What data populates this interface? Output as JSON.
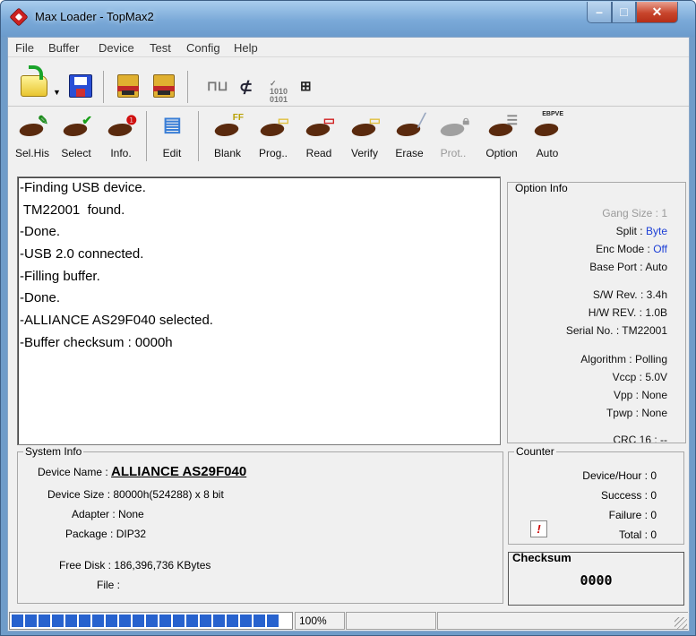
{
  "window": {
    "title": "Max Loader - TopMax2"
  },
  "menu": [
    "File",
    "Buffer",
    "Device",
    "Test",
    "Config",
    "Help"
  ],
  "toolbar_top": [
    {
      "icon": "open-folder-icon"
    },
    {
      "icon": "save-disk-icon"
    },
    {
      "icon": "load-chip-icon"
    },
    {
      "icon": "save-chip-icon"
    },
    {
      "icon": "waveform-icon"
    },
    {
      "icon": "magnifier-chip-icon"
    },
    {
      "icon": "binary-check-icon"
    },
    {
      "icon": "network-icon"
    }
  ],
  "toolbar_main": [
    {
      "label": "Sel.His",
      "icon": "select-history-icon",
      "enabled": true
    },
    {
      "label": "Select",
      "icon": "select-check-icon",
      "enabled": true
    },
    {
      "label": "Info.",
      "icon": "info-icon",
      "enabled": true
    },
    {
      "label": "Edit",
      "icon": "edit-icon",
      "enabled": true
    },
    {
      "label": "Blank",
      "icon": "blank-check-icon",
      "enabled": true
    },
    {
      "label": "Prog..",
      "icon": "program-icon",
      "enabled": true
    },
    {
      "label": "Read",
      "icon": "read-icon",
      "enabled": true
    },
    {
      "label": "Verify",
      "icon": "verify-icon",
      "enabled": true
    },
    {
      "label": "Erase",
      "icon": "erase-icon",
      "enabled": true
    },
    {
      "label": "Prot..",
      "icon": "protect-lock-icon",
      "enabled": false
    },
    {
      "label": "Option",
      "icon": "option-icon",
      "enabled": true
    },
    {
      "label": "Auto",
      "icon": "auto-icon",
      "enabled": true
    }
  ],
  "log": [
    "-Finding USB device.",
    " TM22001  found.",
    "-Done.",
    "-USB 2.0 connected.",
    "-Filling buffer.",
    "-Done.",
    "-ALLIANCE AS29F040 selected.",
    "-Buffer checksum : 0000h"
  ],
  "option_info": {
    "title": "Option Info",
    "rows": [
      {
        "key": "Gang Size : ",
        "value": "1",
        "dim": true
      },
      {
        "key": "Split : ",
        "value": "Byte",
        "blue": true
      },
      {
        "key": "Enc Mode : ",
        "value": "Off",
        "blue": true
      },
      {
        "key": "Base Port : ",
        "value": "Auto"
      },
      {
        "key": "S/W Rev. : ",
        "value": "3.4h"
      },
      {
        "key": "H/W REV. : ",
        "value": "1.0B"
      },
      {
        "key": "Serial No. : ",
        "value": "TM22001"
      },
      {
        "key": "Algorithm : ",
        "value": "Polling"
      },
      {
        "key": "Vccp : ",
        "value": "5.0V"
      },
      {
        "key": "Vpp : ",
        "value": "None"
      },
      {
        "key": "Tpwp : ",
        "value": "None"
      },
      {
        "key": "CRC 16 : ",
        "value": "--"
      }
    ]
  },
  "system_info": {
    "title": "System Info",
    "device_name_key": "Device Name : ",
    "device_name": "ALLIANCE AS29F040",
    "device_size": "Device Size : 80000h(524288) x 8 bit",
    "adapter": "Adapter : None",
    "package": "Package : DIP32",
    "free_disk": "Free Disk : 186,396,736 KBytes",
    "file": "File : "
  },
  "counter": {
    "title": "Counter",
    "device_hour": "Device/Hour : 0",
    "success": "Success : 0",
    "failure": "Failure : 0",
    "total": "Total : 0",
    "alert_glyph": "!"
  },
  "checksum": {
    "title": "Checksum",
    "value": "0000"
  },
  "status": {
    "progress_percent": 100,
    "progress_text": "100%"
  }
}
